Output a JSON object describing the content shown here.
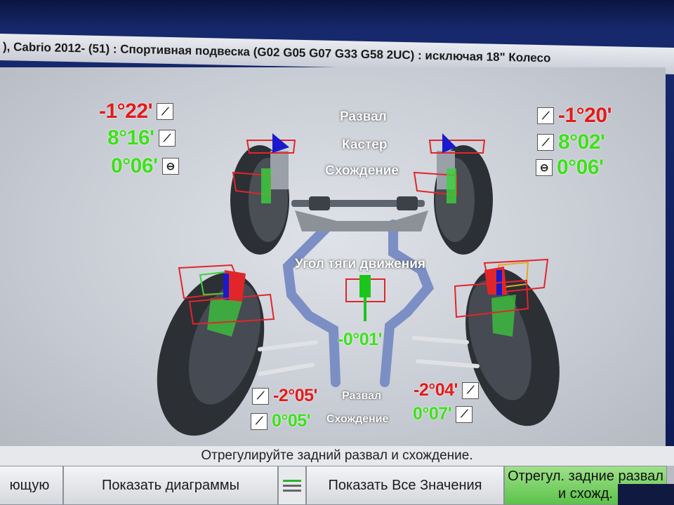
{
  "title_bar": "), Cabrio 2012-  (51) : Спортивная подвеска (G02 G05 G07 G33 G58 2UC) : исключая 18\" Колесо",
  "front": {
    "labels": {
      "camber": "Развал",
      "caster": "Кастер",
      "toe": "Схождение"
    },
    "left": {
      "camber": "-1°22'",
      "caster": "8°16'",
      "toe": "0°06'"
    },
    "right": {
      "camber": "-1°20'",
      "caster": "8°02'",
      "toe": "0°06'"
    }
  },
  "thrust": {
    "label": "Угол тяги движения",
    "value": "-0°01'"
  },
  "rear": {
    "labels": {
      "camber": "Развал",
      "toe": "Схождение"
    },
    "left": {
      "camber": "-2°05'",
      "toe": "0°05'"
    },
    "right": {
      "camber": "-2°04'",
      "toe": "0°07'"
    }
  },
  "status_message": "Отрегулируйте задний развал и схождение.",
  "buttons": {
    "prev": "ющую",
    "show_charts": "Показать диаграммы",
    "show_all": "Показать Все Значения",
    "adjust_rear": "Отрегул. задние развал и схожд."
  },
  "icons": {
    "wrench": "wrench-icon",
    "steering": "steering-wheel-icon"
  },
  "colors": {
    "out_of_spec": "#e21b1b",
    "in_spec": "#3ee01b",
    "highlight_button": "#5cc34a"
  }
}
